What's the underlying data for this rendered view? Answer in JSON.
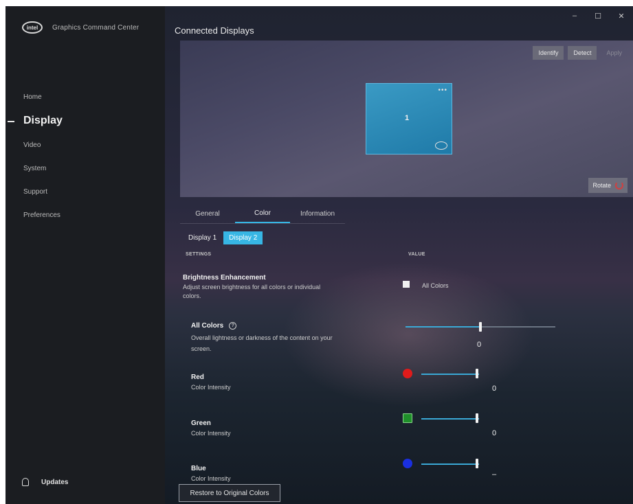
{
  "app": {
    "brand_name": "Graphics Command Center",
    "logo_text": "intel",
    "window_controls": {
      "minimize": "–",
      "maximize": "☐",
      "close": "✕"
    }
  },
  "sidebar": {
    "items": [
      {
        "label": "Home",
        "active": false
      },
      {
        "label": "Display",
        "active": true
      },
      {
        "label": "Video",
        "active": false
      },
      {
        "label": "System",
        "active": false
      },
      {
        "label": "Support",
        "active": false
      },
      {
        "label": "Preferences",
        "active": false
      }
    ],
    "updates_label": "Updates"
  },
  "header": {
    "title": "Connected Displays"
  },
  "preview": {
    "buttons": {
      "identify": "Identify",
      "detect": "Detect",
      "apply": "Apply"
    },
    "monitor_number": "1",
    "monitor_dots": "•••",
    "rotate_label": "Rotate"
  },
  "tabs": [
    {
      "label": "General",
      "active": false
    },
    {
      "label": "Color",
      "active": true
    },
    {
      "label": "Information",
      "active": false
    }
  ],
  "display_selector": {
    "display1": "Display 1",
    "display2": "Display 2"
  },
  "columns": {
    "settings": "SETTINGS",
    "value": "VALUE"
  },
  "brightness": {
    "title": "Brightness Enhancement",
    "desc_line1": "Adjust screen brightness for all colors or individual",
    "desc_line2": "colors.",
    "checkbox_label": "All Colors",
    "checked": true
  },
  "all_colors": {
    "title": "All Colors",
    "info_icon": "?",
    "desc_line1": "Overall lightness or darkness of the content on your",
    "desc_line2": "screen.",
    "value": "0",
    "level": 0.5
  },
  "channels": [
    {
      "name": "Red",
      "desc": "Color Intensity",
      "value": "0",
      "color": "#e01b1b",
      "level": 1.0
    },
    {
      "name": "Green",
      "desc": "Color Intensity",
      "value": "0",
      "color": "#1f8f2a",
      "level": 1.0
    },
    {
      "name": "Blue",
      "desc": "Color Intensity",
      "value": "–",
      "color": "#1a2fe0",
      "level": 1.0
    }
  ],
  "restore_label": "Restore to Original Colors",
  "colors": {
    "accent": "#37b6e4",
    "sidebar": "#1b1d21"
  }
}
